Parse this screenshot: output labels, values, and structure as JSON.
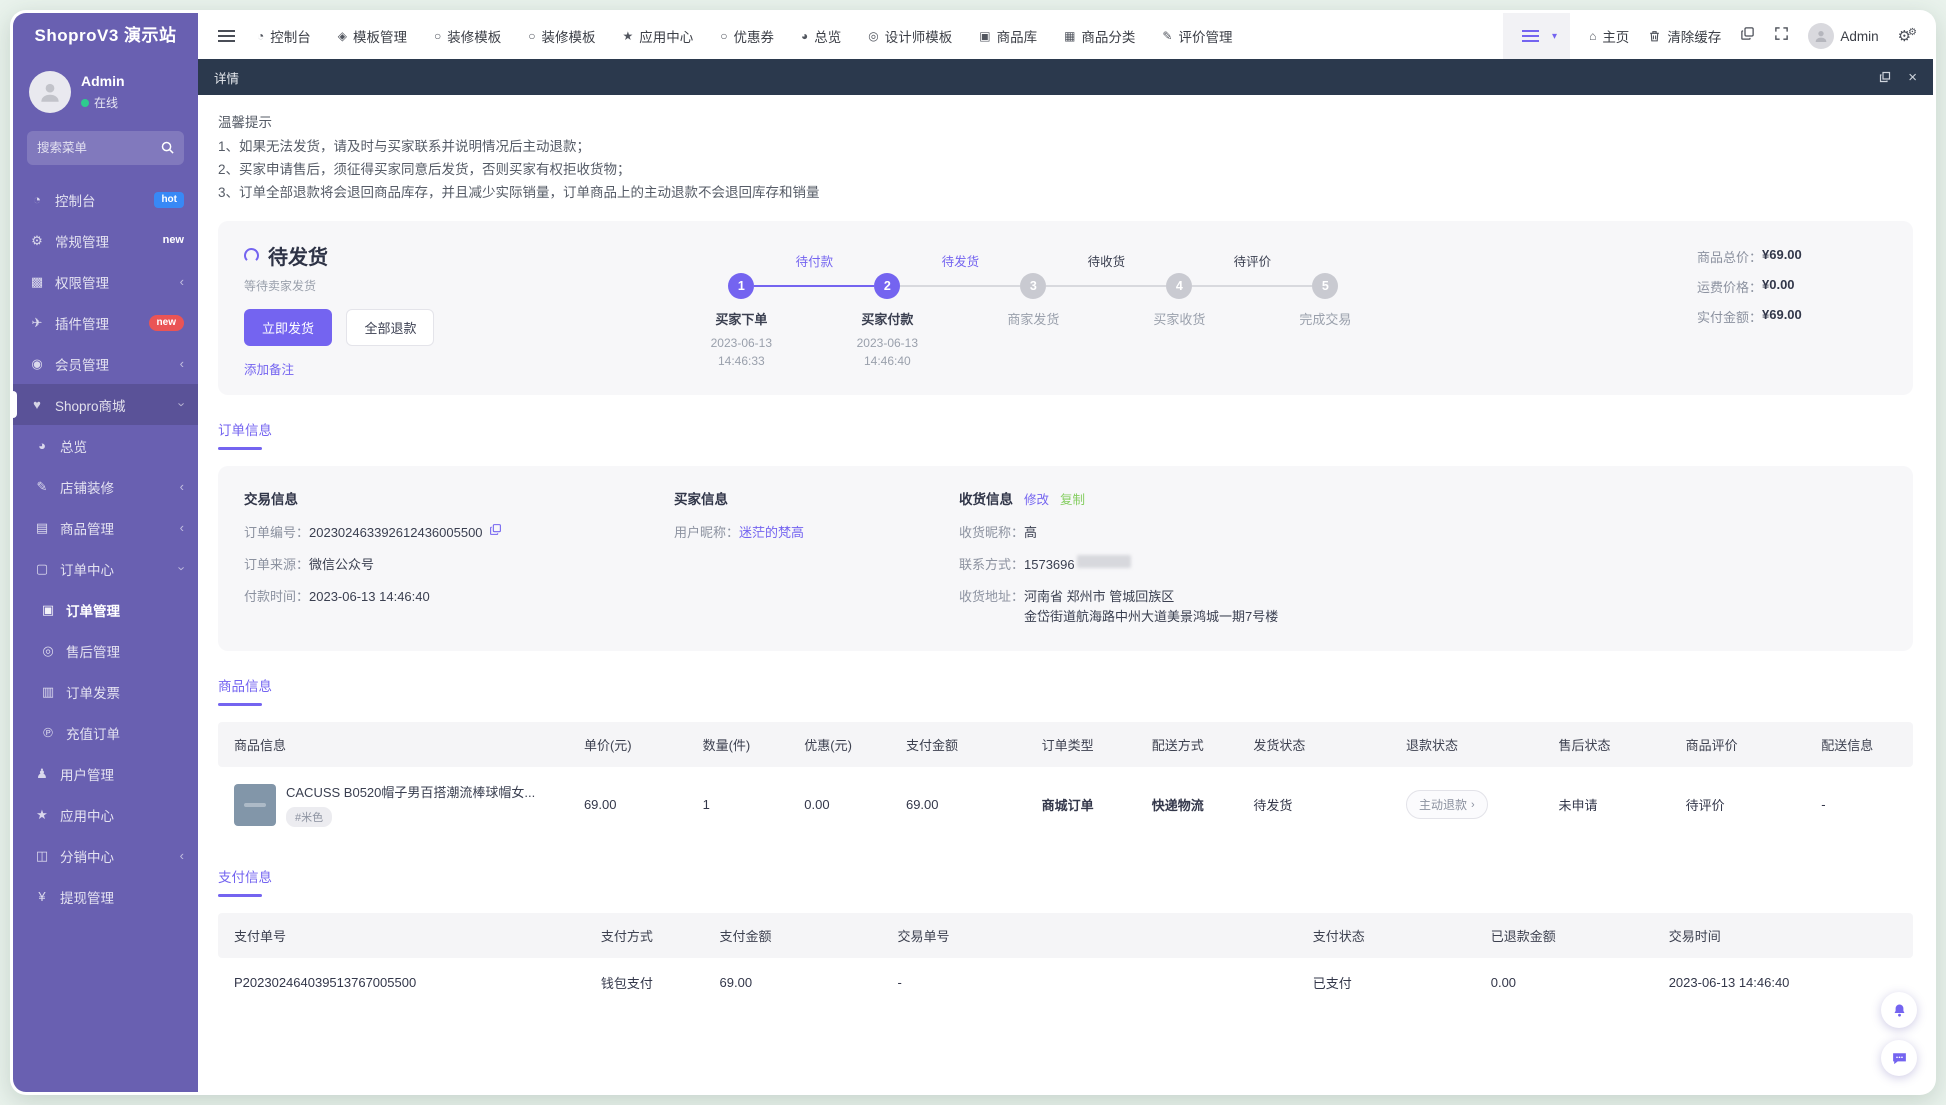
{
  "app_title": "ShoproV3 演示站",
  "colors": {
    "accent": "#7464f0",
    "sidebar": "#6960b1",
    "tabbar": "#2b394d",
    "success": "#85ce61",
    "warning": "#e6a23c",
    "danger": "#ea5455",
    "badge_blue": "#3889f6",
    "online_green": "#2ecc8e"
  },
  "sidebar": {
    "user": {
      "name": "Admin",
      "status_label": "在线"
    },
    "search_placeholder": "搜索菜单",
    "items": [
      {
        "label": "控制台",
        "icon": "dashboard-icon",
        "badge": "hot"
      },
      {
        "label": "常规管理",
        "icon": "gears-icon",
        "badge": "new"
      },
      {
        "label": "权限管理",
        "icon": "permissions-icon"
      },
      {
        "label": "插件管理",
        "icon": "plugin-icon",
        "badge": "new"
      },
      {
        "label": "会员管理",
        "icon": "members-icon"
      },
      {
        "label": "Shopro商城",
        "icon": "shop-icon"
      },
      {
        "label": "总览",
        "icon": "overview-icon"
      },
      {
        "label": "店铺装修",
        "icon": "decorate-icon"
      },
      {
        "label": "商品管理",
        "icon": "goods-icon"
      },
      {
        "label": "订单中心",
        "icon": "order-center-icon"
      },
      {
        "label": "订单管理",
        "icon": "order-manage-icon"
      },
      {
        "label": "售后管理",
        "icon": "aftersale-icon"
      },
      {
        "label": "订单发票",
        "icon": "invoice-icon"
      },
      {
        "label": "充值订单",
        "icon": "recharge-icon"
      },
      {
        "label": "用户管理",
        "icon": "user-manage-icon"
      },
      {
        "label": "应用中心",
        "icon": "app-center-icon"
      },
      {
        "label": "分销中心",
        "icon": "distribution-icon"
      },
      {
        "label": "提现管理",
        "icon": "withdraw-icon"
      }
    ]
  },
  "topnav": {
    "items": [
      {
        "label": "控制台",
        "icon": "dashboard-icon"
      },
      {
        "label": "模板管理",
        "icon": "template-icon"
      },
      {
        "label": "装修模板",
        "icon": "circle-icon"
      },
      {
        "label": "装修模板",
        "icon": "circle-icon"
      },
      {
        "label": "应用中心",
        "icon": "star-icon"
      },
      {
        "label": "优惠券",
        "icon": "coupon-icon"
      },
      {
        "label": "总览",
        "icon": "pie-icon"
      },
      {
        "label": "设计师模板",
        "icon": "globe-icon"
      },
      {
        "label": "商品库",
        "icon": "bag-icon"
      },
      {
        "label": "商品分类",
        "icon": "category-icon"
      },
      {
        "label": "评价管理",
        "icon": "review-icon"
      }
    ],
    "home_label": "主页",
    "clear_cache_label": "清除缓存",
    "user_label": "Admin"
  },
  "tabbar": {
    "title": "详情"
  },
  "tips": {
    "title": "温馨提示",
    "line1": "1、如果无法发货，请及时与买家联系并说明情况后主动退款；",
    "line2": "2、买家申请售后，须征得买家同意后发货，否则买家有权拒收货物；",
    "line3": "3、订单全部退款将会退回商品库存，并且减少实际销量，订单商品上的主动退款不会退回库存和销量"
  },
  "status_card": {
    "title": "待发货",
    "subtitle": "等待卖家发货",
    "ship_button": "立即发货",
    "refund_button": "全部退款",
    "note_link": "添加备注",
    "phase_labels": [
      {
        "text": "待付款"
      },
      {
        "text": "待发货"
      },
      {
        "text": "待收货"
      },
      {
        "text": "待评价"
      }
    ],
    "steps": [
      {
        "num": "1",
        "name": "买家下单",
        "date": "2023-06-13",
        "time": "14:46:33"
      },
      {
        "num": "2",
        "name": "买家付款",
        "date": "2023-06-13",
        "time": "14:46:40"
      },
      {
        "num": "3",
        "name": "商家发货",
        "date": "",
        "time": ""
      },
      {
        "num": "4",
        "name": "买家收货",
        "date": "",
        "time": ""
      },
      {
        "num": "5",
        "name": "完成交易",
        "date": "",
        "time": ""
      }
    ],
    "amounts": [
      {
        "label": "商品总价：",
        "value": "¥69.00"
      },
      {
        "label": "运费价格：",
        "value": "¥0.00"
      },
      {
        "label": "实付金额：",
        "value": "¥69.00"
      }
    ]
  },
  "order_info": {
    "section_title": "订单信息",
    "trade": {
      "title": "交易信息",
      "order_no_label": "订单编号：",
      "order_no": "202302463392612436005500",
      "source_label": "订单来源：",
      "source": "微信公众号",
      "pay_time_label": "付款时间：",
      "pay_time": "2023-06-13 14:46:40"
    },
    "buyer": {
      "title": "买家信息",
      "nickname_label": "用户昵称：",
      "nickname": "迷茫的梵高"
    },
    "receiver": {
      "title": "收货信息",
      "edit_link": "修改",
      "copy_link": "复制",
      "name_label": "收货昵称：",
      "name": "高",
      "phone_label": "联系方式：",
      "phone": "1573696",
      "address_label": "收货地址：",
      "address1": "河南省 郑州市 管城回族区",
      "address2": "金岱街道航海路中州大道美景鸿城一期7号楼"
    }
  },
  "product_section": {
    "section_title": "商品信息",
    "headers": [
      "商品信息",
      "单价(元)",
      "数量(件)",
      "优惠(元)",
      "支付金额",
      "订单类型",
      "配送方式",
      "发货状态",
      "退款状态",
      "售后状态",
      "商品评价",
      "配送信息"
    ],
    "row": {
      "name": "CACUSS B0520帽子男百搭潮流棒球帽女...",
      "sku": "#米色",
      "price": "69.00",
      "qty": "1",
      "discount": "0.00",
      "pay_amount": "69.00",
      "order_type": "商城订单",
      "delivery": "快递物流",
      "ship_status": "待发货",
      "refund_status": "主动退款",
      "refund_chevron": "›",
      "aftersale_status": "未申请",
      "review_status": "待评价",
      "delivery_info": "-"
    }
  },
  "payment_section": {
    "section_title": "支付信息",
    "headers": [
      "支付单号",
      "支付方式",
      "支付金额",
      "交易单号",
      "支付状态",
      "已退款金额",
      "交易时间"
    ],
    "row": {
      "pay_no": "P202302464039513767005500",
      "method": "钱包支付",
      "amount": "69.00",
      "trade_no": "-",
      "status": "已支付",
      "refunded": "0.00",
      "time": "2023-06-13 14:46:40"
    }
  }
}
